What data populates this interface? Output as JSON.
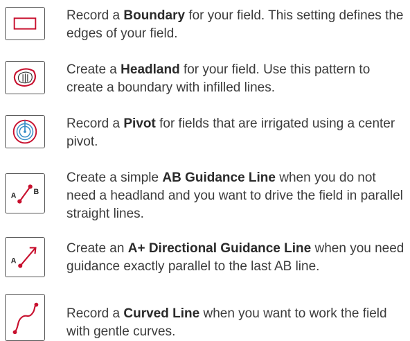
{
  "accent": "#c8102e",
  "pivot_blue": "#3a8fc8",
  "items": [
    {
      "icon": "boundary-icon",
      "pre": "Record a ",
      "bold": "Boundary",
      "post": " for your field. This setting defines the edges of your field."
    },
    {
      "icon": "headland-icon",
      "pre": "Create a ",
      "bold": "Headland",
      "post": " for your field. Use this pattern to create a boundary with infilled lines."
    },
    {
      "icon": "pivot-icon",
      "pre": "Record a ",
      "bold": "Pivot",
      "post": " for fields that are irrigated using a center pivot."
    },
    {
      "icon": "ab-guidance-line-icon",
      "icon_label_a": "A",
      "icon_label_b": "B",
      "pre": "Create a simple ",
      "bold": "AB Guidance Line",
      "post": " when you do not need a headland and you want to drive the field in parallel straight lines."
    },
    {
      "icon": "a-plus-directional-line-icon",
      "icon_label_a": "A",
      "pre": "Create an ",
      "bold": "A+ Directional Guidance Line",
      "post": " when you need guidance exactly parallel to the last AB line."
    },
    {
      "icon": "curved-line-icon",
      "pre": "Record a ",
      "bold": "Curved Line",
      "post": " when you want to work the field with gentle curves."
    }
  ]
}
